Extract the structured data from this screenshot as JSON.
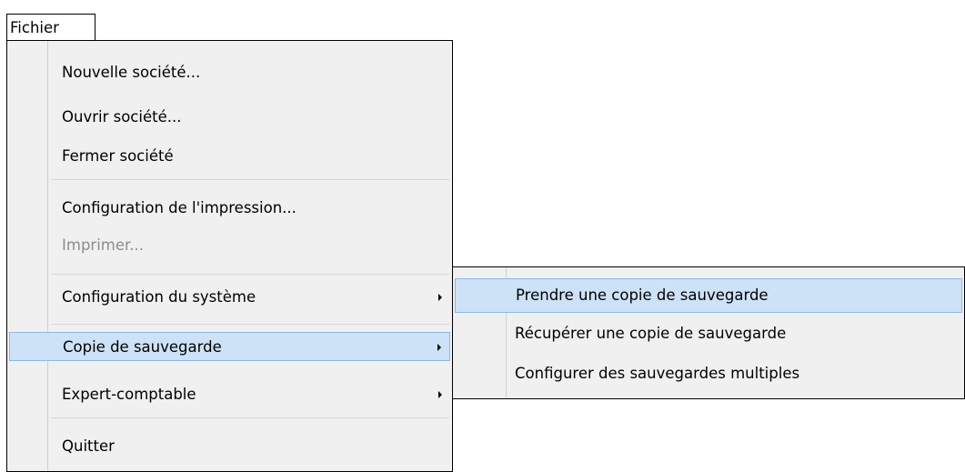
{
  "menubar": {
    "fichier": "Fichier"
  },
  "main_menu": {
    "items": [
      {
        "label": "Nouvelle société..."
      },
      {
        "label": "Ouvrir société..."
      },
      {
        "label": "Fermer société"
      },
      {
        "label": "Configuration de l'impression..."
      },
      {
        "label": "Imprimer...",
        "disabled": true
      },
      {
        "label": "Configuration du système",
        "submenu": true
      },
      {
        "label": "Copie de sauvegarde",
        "submenu": true,
        "selected": true
      },
      {
        "label": "Expert-comptable",
        "submenu": true
      },
      {
        "label": "Quitter"
      }
    ]
  },
  "sub_menu": {
    "items": [
      {
        "label": "Prendre une copie de sauvegarde",
        "selected": true
      },
      {
        "label": "Récupérer une copie de sauvegarde"
      },
      {
        "label": "Configurer des sauvegardes multiples"
      }
    ]
  },
  "colors": {
    "menu_bg": "#f0f0f0",
    "highlight": "#cde2f7",
    "highlight_border": "#8fb8e6",
    "disabled_text": "#8d8d8d"
  }
}
